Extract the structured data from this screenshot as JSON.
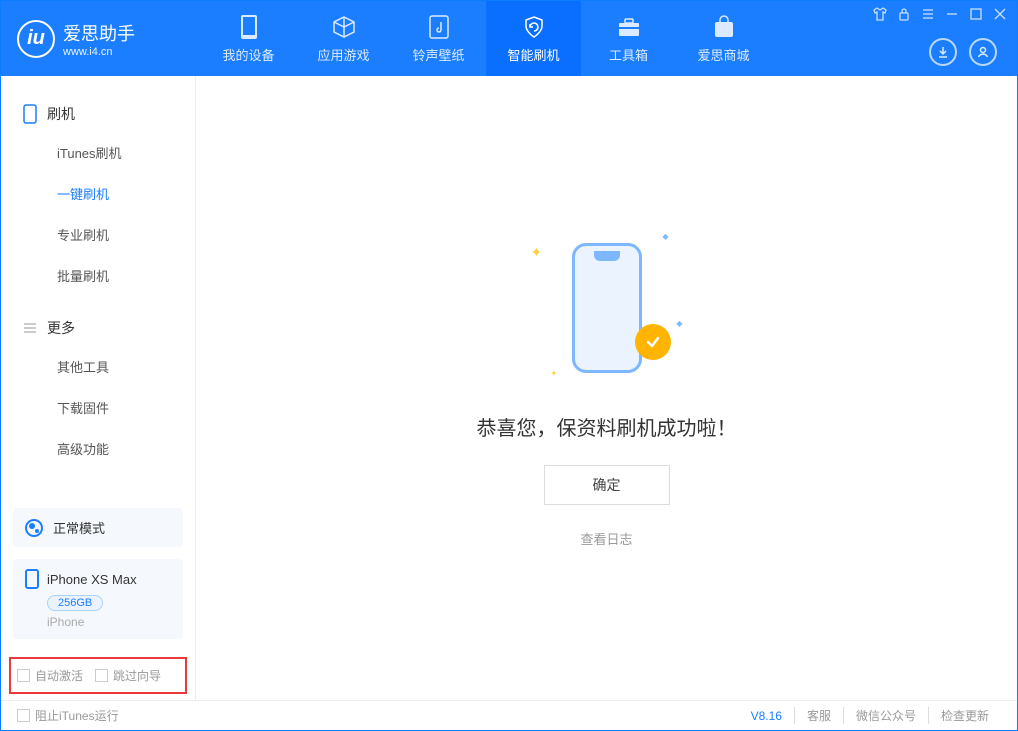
{
  "app": {
    "title": "爱思助手",
    "url": "www.i4.cn"
  },
  "nav": {
    "my_device": "我的设备",
    "apps": "应用游戏",
    "ringtones": "铃声壁纸",
    "flash": "智能刷机",
    "toolbox": "工具箱",
    "store": "爱思商城"
  },
  "sidebar": {
    "group_flash": "刷机",
    "items_flash": {
      "itunes": "iTunes刷机",
      "oneclick": "一键刷机",
      "pro": "专业刷机",
      "batch": "批量刷机"
    },
    "group_more": "更多",
    "items_more": {
      "other": "其他工具",
      "firmware": "下载固件",
      "advanced": "高级功能"
    },
    "mode": "正常模式",
    "device": {
      "name": "iPhone XS Max",
      "capacity": "256GB",
      "type": "iPhone"
    },
    "auto_activate": "自动激活",
    "skip_guide": "跳过向导"
  },
  "main": {
    "success": "恭喜您，保资料刷机成功啦！",
    "ok": "确定",
    "view_log": "查看日志"
  },
  "footer": {
    "block_itunes": "阻止iTunes运行",
    "version": "V8.16",
    "support": "客服",
    "wechat": "微信公众号",
    "update": "检查更新"
  }
}
